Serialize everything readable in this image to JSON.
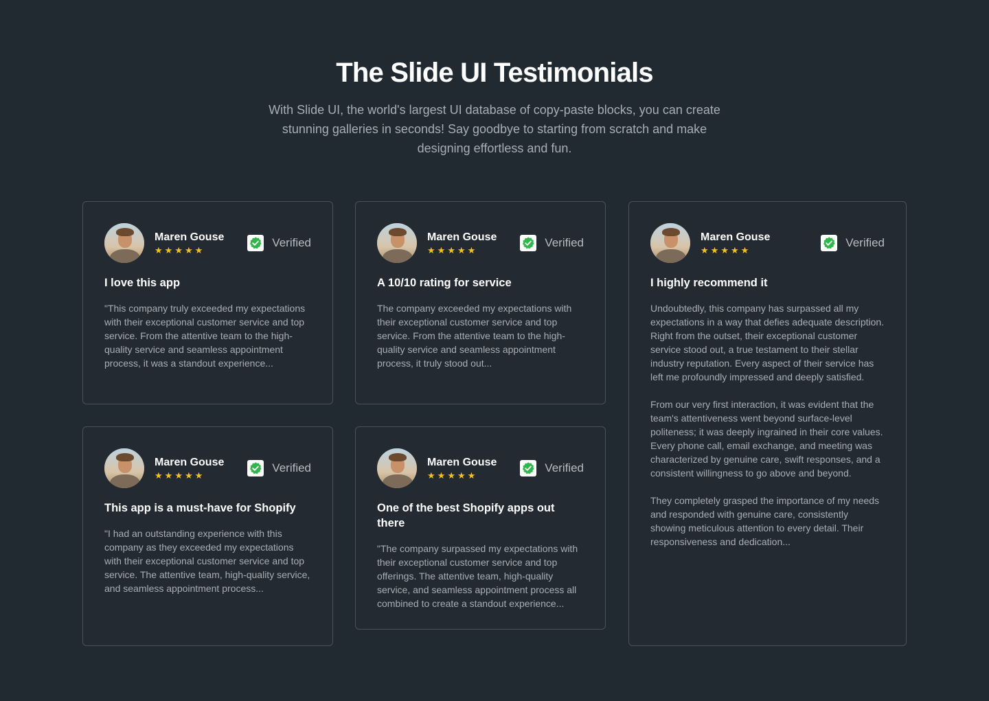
{
  "header": {
    "title": "The Slide UI Testimonials",
    "subtitle": "With Slide UI, the world's largest UI database of copy-paste blocks, you can create stunning galleries in seconds! Say goodbye to starting from scratch and make designing effortless and fun."
  },
  "colors": {
    "background": "#222a31",
    "card_border": "#4a5159",
    "star": "#f6c21a",
    "verified_green": "#2fb84a"
  },
  "cards": [
    {
      "name": "Maren Gouse",
      "rating": 5,
      "verified_label": "Verified",
      "title": "I love this app",
      "paragraphs": [
        "\"This company truly exceeded my expectations with their exceptional customer service and top service. From the attentive team to the high-quality service and seamless appointment process, it was a standout experience..."
      ]
    },
    {
      "name": "Maren Gouse",
      "rating": 5,
      "verified_label": "Verified",
      "title": "A 10/10 rating for service",
      "paragraphs": [
        "The company exceeded my expectations with their exceptional customer service and top service. From the attentive team to the high-quality service and seamless appointment process, it truly stood out..."
      ]
    },
    {
      "name": "Maren Gouse",
      "rating": 5,
      "verified_label": "Verified",
      "title": "I highly recommend it",
      "paragraphs": [
        "Undoubtedly, this company has surpassed all my expectations in a way that defies adequate description. Right from the outset, their exceptional customer service stood out, a true testament to their stellar industry reputation. Every aspect of their service has left me profoundly impressed and deeply satisfied.",
        "From our very first interaction, it was evident that the team's attentiveness went beyond surface-level politeness; it was deeply ingrained in their core values. Every phone call, email exchange, and meeting was characterized by genuine care, swift responses, and a consistent willingness to go above and beyond.",
        "They completely grasped the importance of my needs and responded with genuine care, consistently showing meticulous attention to every detail. Their responsiveness and dedication..."
      ]
    },
    {
      "name": "Maren Gouse",
      "rating": 5,
      "verified_label": "Verified",
      "title": "This app is a must-have for Shopify",
      "paragraphs": [
        "\"I had an outstanding experience with this company as they exceeded my expectations with their exceptional customer service and top service. The attentive team, high-quality service, and seamless appointment process..."
      ]
    },
    {
      "name": "Maren Gouse",
      "rating": 5,
      "verified_label": "Verified",
      "title": "One of the best Shopify apps out there",
      "paragraphs": [
        "\"The company surpassed my expectations with their exceptional customer service and top offerings. The attentive team, high-quality service, and seamless appointment process all combined to create a standout experience..."
      ]
    }
  ]
}
